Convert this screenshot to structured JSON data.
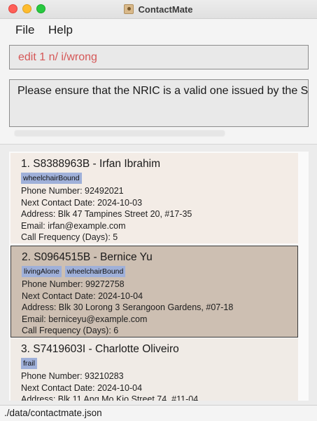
{
  "window": {
    "title": "ContactMate",
    "icon": "contact-book-icon"
  },
  "menu": {
    "file": "File",
    "help": "Help"
  },
  "command_box": {
    "value": "edit 1 n/ i/wrong",
    "text_color": "#d55757"
  },
  "result_box": {
    "text": "Please ensure that the NRIC is a valid one issued by the Sin"
  },
  "persons": [
    {
      "header": "1. S8388963B - Irfan Ibrahim",
      "tags": [
        "wheelchairBound"
      ],
      "phone": "Phone Number: 92492021",
      "next_contact": "Next Contact Date:  2024-10-03",
      "address": "Address: Blk 47 Tampines Street 20, #17-35",
      "email": "Email: irfan@example.com",
      "call_frequency": "Call Frequency (Days): 5"
    },
    {
      "header": "2. S0964515B - Bernice Yu",
      "tags": [
        "livingAlone",
        "wheelchairBound"
      ],
      "phone": "Phone Number: 99272758",
      "next_contact": "Next Contact Date:  2024-10-04",
      "address": "Address: Blk 30 Lorong 3 Serangoon Gardens, #07-18",
      "email": "Email: berniceyu@example.com",
      "call_frequency": "Call Frequency (Days): 6"
    },
    {
      "header": "3. S7419603I - Charlotte Oliveiro",
      "tags": [
        "frail"
      ],
      "phone": "Phone Number: 93210283",
      "next_contact": "Next Contact Date:  2024-10-04",
      "address": "Address: Blk 11 Ang Mo Kio Street 74, #11-04"
    }
  ],
  "status_bar": {
    "path": "./data/contactmate.json"
  },
  "colors": {
    "selected_card": "#cdbfb2",
    "card": "#f3ece6",
    "tag": "#9fb0d9"
  }
}
